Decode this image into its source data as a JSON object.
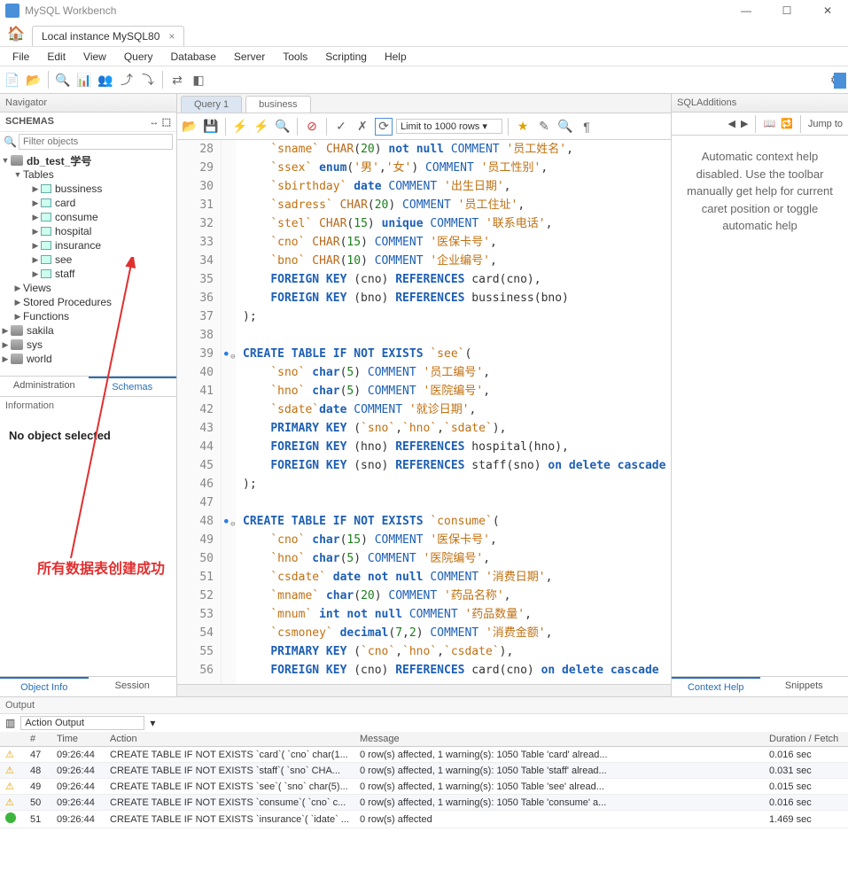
{
  "app": {
    "title": "MySQL Workbench"
  },
  "connection_tab": {
    "label": "Local instance MySQL80"
  },
  "menubar": [
    "File",
    "Edit",
    "View",
    "Query",
    "Database",
    "Server",
    "Tools",
    "Scripting",
    "Help"
  ],
  "navigator": {
    "title": "Navigator",
    "schemas_label": "SCHEMAS",
    "filter_placeholder": "Filter objects",
    "db_name": "db_test_学号",
    "tables_label": "Tables",
    "tables": [
      "bussiness",
      "card",
      "consume",
      "hospital",
      "insurance",
      "see",
      "staff"
    ],
    "views_label": "Views",
    "sp_label": "Stored Procedures",
    "fn_label": "Functions",
    "other_dbs": [
      "sakila",
      "sys",
      "world"
    ],
    "tabs": {
      "admin": "Administration",
      "schemas": "Schemas"
    },
    "info_label": "Information",
    "no_object": "No object selected",
    "bottom_tabs": {
      "objinfo": "Object Info",
      "session": "Session"
    }
  },
  "editor": {
    "tabs": {
      "q1": "Query 1",
      "biz": "business"
    },
    "limit_label": "Limit to 1000 rows",
    "lines": [
      {
        "n": 28,
        "html": "    <span class='bq'>`sname`</span> <span class='dt'>CHAR</span>(<span class='num'>20</span>) <span class='kw'>not null</span> <span class='cm'>COMMENT</span> <span class='str'>'员工姓名'</span>,"
      },
      {
        "n": 29,
        "html": "    <span class='bq'>`ssex`</span> <span class='kw'>enum</span>(<span class='str'>'男'</span>,<span class='str'>'女'</span>) <span class='cm'>COMMENT</span> <span class='str'>'员工性别'</span>,"
      },
      {
        "n": 30,
        "html": "    <span class='bq'>`sbirthday`</span> <span class='kw'>date</span> <span class='cm'>COMMENT</span> <span class='str'>'出生日期'</span>,"
      },
      {
        "n": 31,
        "html": "    <span class='bq'>`sadress`</span> <span class='dt'>CHAR</span>(<span class='num'>20</span>) <span class='cm'>COMMENT</span> <span class='str'>'员工住址'</span>,"
      },
      {
        "n": 32,
        "html": "    <span class='bq'>`stel`</span> <span class='dt'>CHAR</span>(<span class='num'>15</span>) <span class='kw'>unique</span> <span class='cm'>COMMENT</span> <span class='str'>'联系电话'</span>,"
      },
      {
        "n": 33,
        "html": "    <span class='bq'>`cno`</span> <span class='dt'>CHAR</span>(<span class='num'>15</span>) <span class='cm'>COMMENT</span> <span class='str'>'医保卡号'</span>,"
      },
      {
        "n": 34,
        "html": "    <span class='bq'>`bno`</span> <span class='dt'>CHAR</span>(<span class='num'>10</span>) <span class='cm'>COMMENT</span> <span class='str'>'企业编号'</span>,"
      },
      {
        "n": 35,
        "html": "    <span class='kw'>FOREIGN KEY</span> (cno) <span class='kw'>REFERENCES</span> card(cno),"
      },
      {
        "n": 36,
        "html": "    <span class='kw'>FOREIGN KEY</span> (bno) <span class='kw'>REFERENCES</span> bussiness(bno)"
      },
      {
        "n": 37,
        "html": ");"
      },
      {
        "n": 38,
        "html": ""
      },
      {
        "n": 39,
        "dot": true,
        "fold": "⊖",
        "html": "<span class='kw'>CREATE</span> <span class='kw'>TABLE</span> <span class='kw'>IF</span> <span class='kw'>NOT</span> <span class='kw'>EXISTS</span> <span class='bq'>`see`</span>("
      },
      {
        "n": 40,
        "html": "    <span class='bq'>`sno`</span> <span class='kw'>char</span>(<span class='num'>5</span>) <span class='cm'>COMMENT</span> <span class='str'>'员工编号'</span>,"
      },
      {
        "n": 41,
        "html": "    <span class='bq'>`hno`</span> <span class='kw'>char</span>(<span class='num'>5</span>) <span class='cm'>COMMENT</span> <span class='str'>'医院编号'</span>,"
      },
      {
        "n": 42,
        "html": "    <span class='bq'>`sdate`</span><span class='kw'>date</span> <span class='cm'>COMMENT</span> <span class='str'>'就诊日期'</span>,"
      },
      {
        "n": 43,
        "html": "    <span class='kw'>PRIMARY KEY</span> (<span class='bq'>`sno`</span>,<span class='bq'>`hno`</span>,<span class='bq'>`sdate`</span>),"
      },
      {
        "n": 44,
        "html": "    <span class='kw'>FOREIGN KEY</span> (hno) <span class='kw'>REFERENCES</span> hospital(hno),"
      },
      {
        "n": 45,
        "html": "    <span class='kw'>FOREIGN KEY</span> (sno) <span class='kw'>REFERENCES</span> staff(sno) <span class='kw'>on delete cascade</span>"
      },
      {
        "n": 46,
        "html": ");"
      },
      {
        "n": 47,
        "html": ""
      },
      {
        "n": 48,
        "dot": true,
        "fold": "⊖",
        "html": "<span class='kw'>CREATE</span> <span class='kw'>TABLE</span> <span class='kw'>IF</span> <span class='kw'>NOT</span> <span class='kw'>EXISTS</span> <span class='bq'>`consume`</span>("
      },
      {
        "n": 49,
        "html": "    <span class='bq'>`cno`</span> <span class='kw'>char</span>(<span class='num'>15</span>) <span class='cm'>COMMENT</span> <span class='str'>'医保卡号'</span>,"
      },
      {
        "n": 50,
        "html": "    <span class='bq'>`hno`</span> <span class='kw'>char</span>(<span class='num'>5</span>) <span class='cm'>COMMENT</span> <span class='str'>'医院编号'</span>,"
      },
      {
        "n": 51,
        "html": "    <span class='bq'>`csdate`</span> <span class='kw'>date not null</span> <span class='cm'>COMMENT</span> <span class='str'>'消费日期'</span>,"
      },
      {
        "n": 52,
        "html": "    <span class='bq'>`mname`</span> <span class='kw'>char</span>(<span class='num'>20</span>) <span class='cm'>COMMENT</span> <span class='str'>'药品名称'</span>,"
      },
      {
        "n": 53,
        "html": "    <span class='bq'>`mnum`</span> <span class='kw'>int not null</span> <span class='cm'>COMMENT</span> <span class='str'>'药品数量'</span>,"
      },
      {
        "n": 54,
        "html": "    <span class='bq'>`csmoney`</span> <span class='kw'>decimal</span>(<span class='num'>7</span>,<span class='num'>2</span>) <span class='cm'>COMMENT</span> <span class='str'>'消费金额'</span>,"
      },
      {
        "n": 55,
        "html": "    <span class='kw'>PRIMARY KEY</span> (<span class='bq'>`cno`</span>,<span class='bq'>`hno`</span>,<span class='bq'>`csdate`</span>),"
      },
      {
        "n": 56,
        "html": "    <span class='kw'>FOREIGN KEY</span> (cno) <span class='kw'>REFERENCES</span> card(cno) <span class='kw'>on delete cascade</span>"
      }
    ]
  },
  "right": {
    "title": "SQLAdditions",
    "jump": "Jump to",
    "body": "Automatic context help disabled. Use the toolbar manually get help for current caret position or toggle automatic help",
    "tabs": {
      "ctx": "Context Help",
      "snip": "Snippets"
    }
  },
  "output": {
    "title": "Output",
    "select_label": "Action Output",
    "headers": [
      "",
      "#",
      "Time",
      "Action",
      "Message",
      "Duration / Fetch"
    ],
    "rows": [
      {
        "icon": "warn",
        "n": 47,
        "time": "09:26:44",
        "action": "CREATE TABLE IF NOT EXISTS `card`(    `cno` char(1...",
        "msg": "0 row(s) affected, 1 warning(s): 1050 Table 'card' alread...",
        "dur": "0.016 sec"
      },
      {
        "icon": "warn",
        "n": 48,
        "time": "09:26:44",
        "action": "CREATE TABLE IF NOT EXISTS `staff`(    `sno` CHA...",
        "msg": "0 row(s) affected, 1 warning(s): 1050 Table 'staff' alread...",
        "dur": "0.031 sec"
      },
      {
        "icon": "warn",
        "n": 49,
        "time": "09:26:44",
        "action": "CREATE TABLE IF NOT EXISTS `see`(    `sno` char(5)...",
        "msg": "0 row(s) affected, 1 warning(s): 1050 Table 'see' alread...",
        "dur": "0.015 sec"
      },
      {
        "icon": "warn",
        "n": 50,
        "time": "09:26:44",
        "action": "CREATE TABLE IF NOT EXISTS `consume`(    `cno` c...",
        "msg": "0 row(s) affected, 1 warning(s): 1050 Table 'consume' a...",
        "dur": "0.016 sec"
      },
      {
        "icon": "ok",
        "n": 51,
        "time": "09:26:44",
        "action": "CREATE TABLE IF NOT EXISTS `insurance`(    `idate` ...",
        "msg": "0 row(s) affected",
        "dur": "1.469 sec"
      }
    ]
  },
  "annotation": "所有数据表创建成功"
}
